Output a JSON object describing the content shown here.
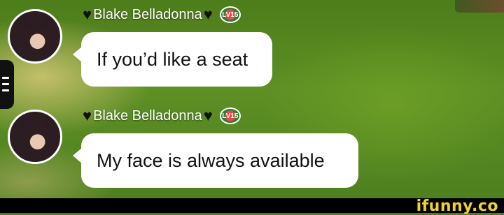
{
  "messages": [
    {
      "author": "Blake Belladonna",
      "heart_left": "♥",
      "heart_right": "♥",
      "level": "LV15",
      "text": "If you’d like a seat"
    },
    {
      "author": "Blake Belladonna",
      "heart_left": "♥",
      "heart_right": "♥",
      "level": "LV15",
      "text": "My face is always available"
    }
  ],
  "watermark": "ifunny.co",
  "colors": {
    "bubble": "#ffffff",
    "grass": "#5d8f24",
    "name": "#ffffff",
    "heart": "#111111",
    "watermark": "#f2d22c"
  }
}
